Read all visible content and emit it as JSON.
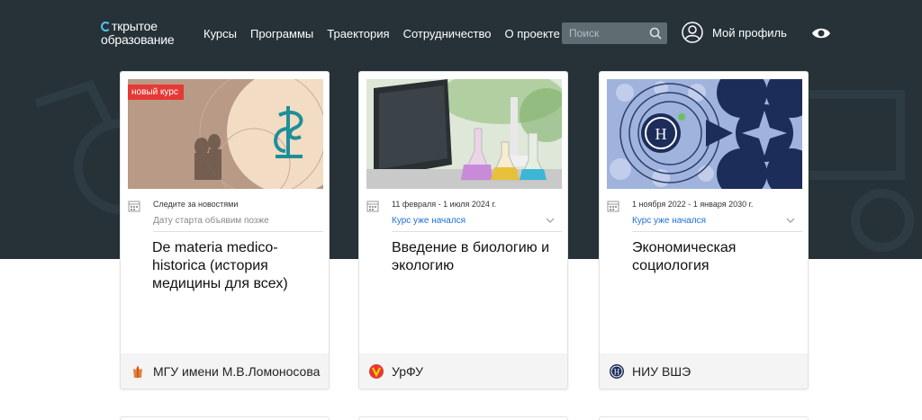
{
  "header": {
    "logo_line1": "ткрытое",
    "logo_line2": "образование",
    "nav": [
      "Курсы",
      "Программы",
      "Траектория",
      "Сотрудничество",
      "О проекте"
    ],
    "search_placeholder": "Поиск",
    "profile_label": "Мой профиль"
  },
  "colors": {
    "hero_bg": "#263238",
    "accent_blue": "#1e6fd9",
    "new_badge": "#e53935"
  },
  "cards": [
    {
      "badge": "новый курс",
      "date": "Следите за новостями",
      "status": "Дату старта объявим позже",
      "title": "De materia medico-historica (история медицины для всех)",
      "university": "МГУ имени М.В.Ломоносова",
      "university_icon": "msu-logo-icon"
    },
    {
      "date": "11 февраля - 1 июля 2024 г.",
      "status": "Курс уже начался",
      "title": "Введение в биологию и экологию",
      "university": "УрФУ",
      "university_icon": "urfu-logo-icon"
    },
    {
      "date": "1 ноября 2022 - 1 января 2030 г.",
      "status": "Курс уже начался",
      "title": "Экономическая социология",
      "university": "НИУ ВШЭ",
      "university_icon": "hse-logo-icon"
    }
  ]
}
